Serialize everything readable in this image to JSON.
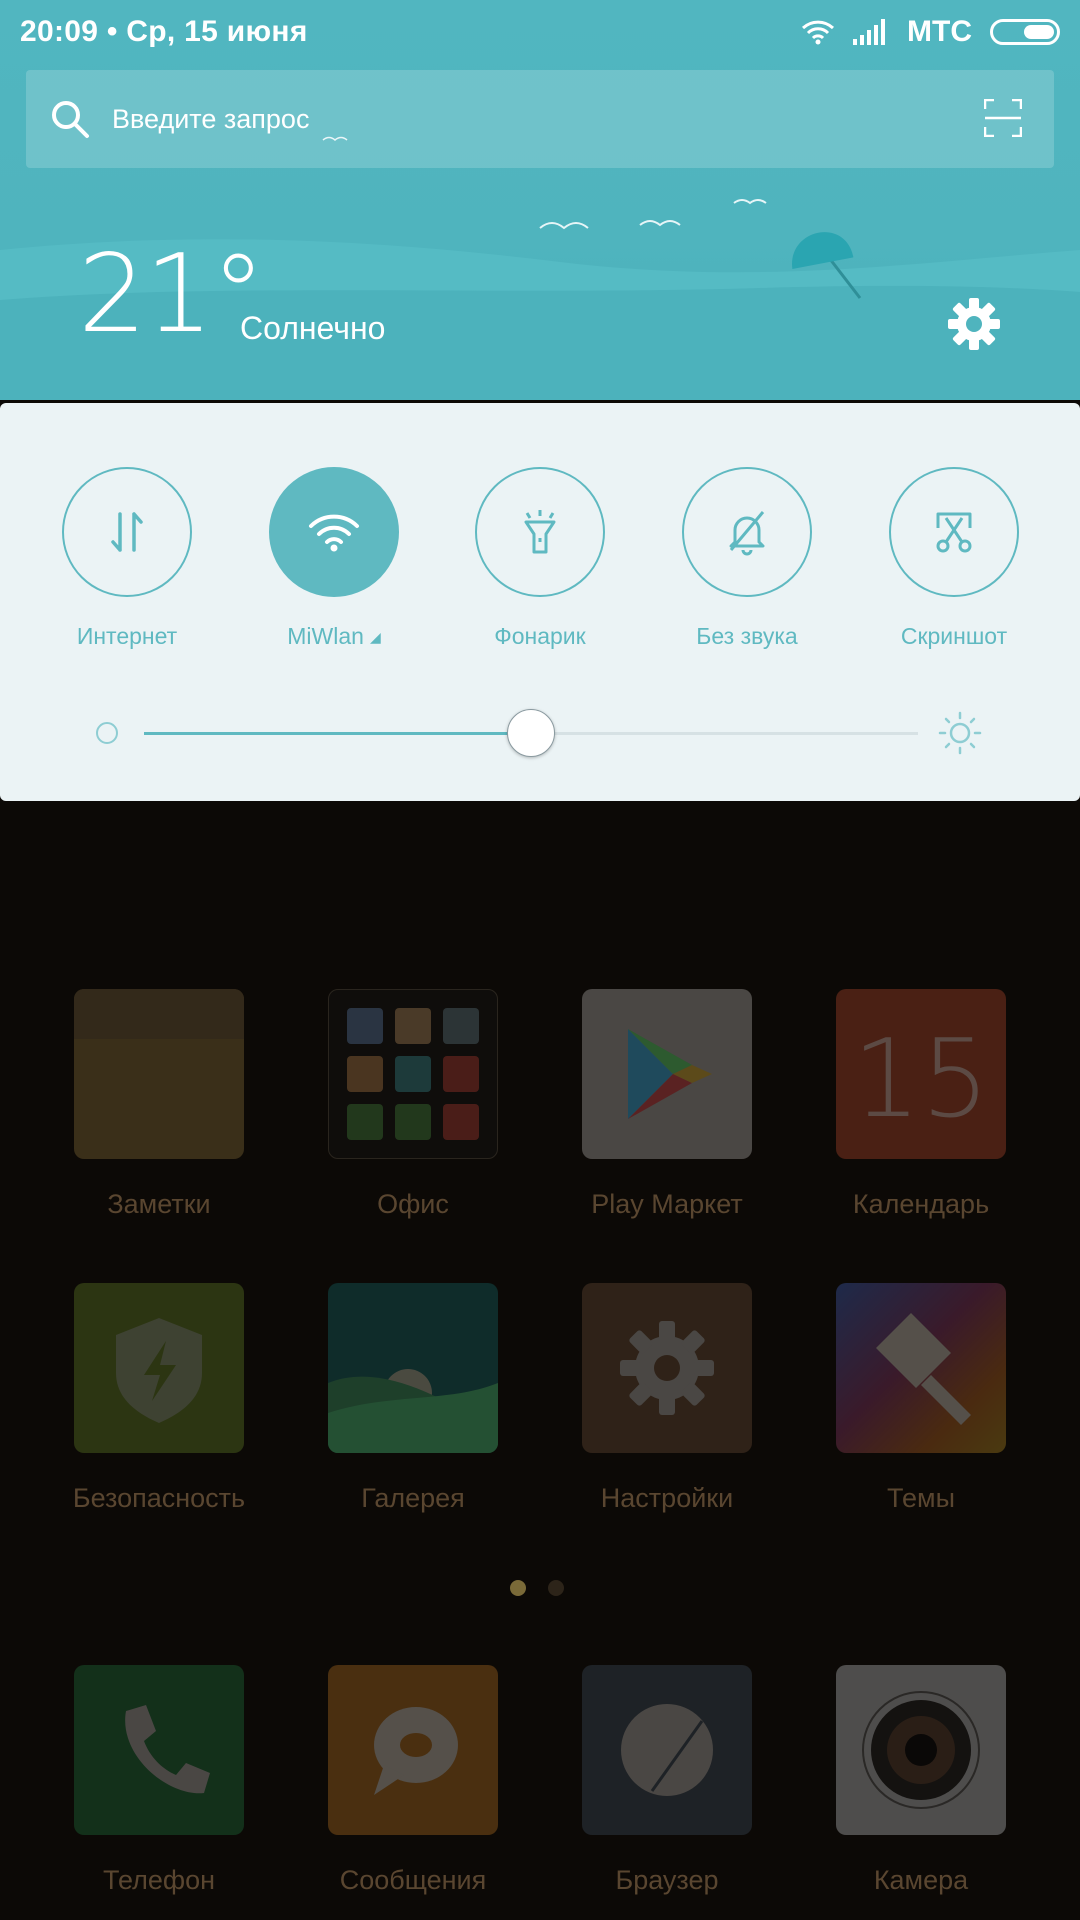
{
  "status_bar": {
    "time_date": "20:09 • Ср, 15 июня",
    "carrier": "МТС",
    "icons": [
      "wifi-icon",
      "signal-icon",
      "battery-icon"
    ]
  },
  "search": {
    "placeholder": "Введите запрос",
    "icons": [
      "search-icon",
      "scan-icon"
    ]
  },
  "weather": {
    "temperature": "21°",
    "condition": "Солнечно",
    "settings_icon": "gear-icon"
  },
  "quick_settings": {
    "toggles": [
      {
        "label": "Интернет",
        "icon": "mobile-data-icon",
        "active": false
      },
      {
        "label": "MiWlan",
        "icon": "wifi-icon",
        "active": true,
        "has_dropdown": true
      },
      {
        "label": "Фонарик",
        "icon": "flashlight-icon",
        "active": false
      },
      {
        "label": "Без звука",
        "icon": "bell-off-icon",
        "active": false
      },
      {
        "label": "Скриншот",
        "icon": "screenshot-icon",
        "active": false
      }
    ],
    "brightness_level": 0.5,
    "accent_color": "#5fb9c1"
  },
  "home": {
    "apps": [
      {
        "label": "Заметки",
        "icon": "notes-icon"
      },
      {
        "label": "Офис",
        "icon": "office-folder-icon"
      },
      {
        "label": "Play Маркет",
        "icon": "play-store-icon"
      },
      {
        "label": "Календарь",
        "icon": "calendar-icon",
        "icon_text": "15"
      },
      {
        "label": "Безопасность",
        "icon": "security-shield-icon"
      },
      {
        "label": "Галерея",
        "icon": "gallery-icon"
      },
      {
        "label": "Настройки",
        "icon": "settings-gear-icon"
      },
      {
        "label": "Темы",
        "icon": "themes-brush-icon"
      }
    ],
    "page_count": 2,
    "current_page": 1,
    "dock": [
      {
        "label": "Телефон",
        "icon": "phone-icon"
      },
      {
        "label": "Сообщения",
        "icon": "messages-icon"
      },
      {
        "label": "Браузер",
        "icon": "browser-icon"
      },
      {
        "label": "Камера",
        "icon": "camera-icon"
      }
    ]
  }
}
